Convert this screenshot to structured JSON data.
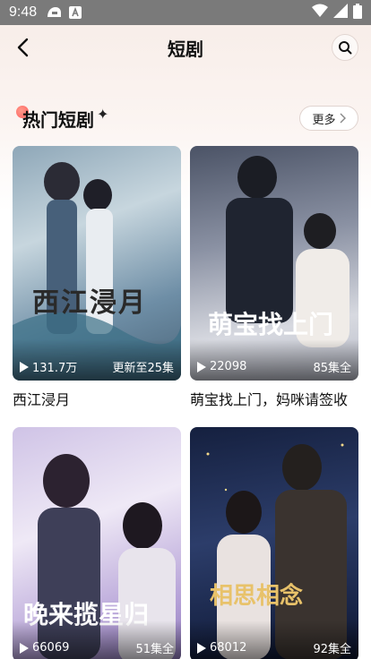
{
  "status_bar": {
    "time": "9:48",
    "icons": [
      "notification-icon",
      "font-a-icon",
      "wifi-icon",
      "signal-icon",
      "battery-icon"
    ]
  },
  "nav": {
    "title": "短剧",
    "back_icon": "chevron-left-icon",
    "search_icon": "search-icon"
  },
  "section": {
    "title": "热门短剧",
    "more_label": "更多"
  },
  "dramas": [
    {
      "title": "西江浸月",
      "views": "131.7万",
      "episodes": "更新至25集",
      "poster_text": "西江浸月",
      "colors": [
        "#6b8aa3",
        "#a9bfcf",
        "#3d5468"
      ]
    },
    {
      "title": "萌宝找上门，妈咪请签收",
      "views": "22098",
      "episodes": "85集全",
      "poster_text": "萌宝找上门",
      "colors": [
        "#5a6478",
        "#c9ccd6",
        "#2e3342"
      ]
    },
    {
      "title": "晚来揽星归",
      "views": "66069",
      "episodes": "51集全",
      "poster_text": "晚来揽星归",
      "colors": [
        "#b7a9d1",
        "#e6dff0",
        "#7d6aa2"
      ]
    },
    {
      "title": "相思相念",
      "views": "68012",
      "episodes": "92集全",
      "poster_text": "相思相念",
      "colors": [
        "#1d2a4f",
        "#3e4f7a",
        "#0f1630"
      ]
    }
  ],
  "colors": {
    "status_bar": "#7a7a7a",
    "accent": "#ff5f5f"
  }
}
